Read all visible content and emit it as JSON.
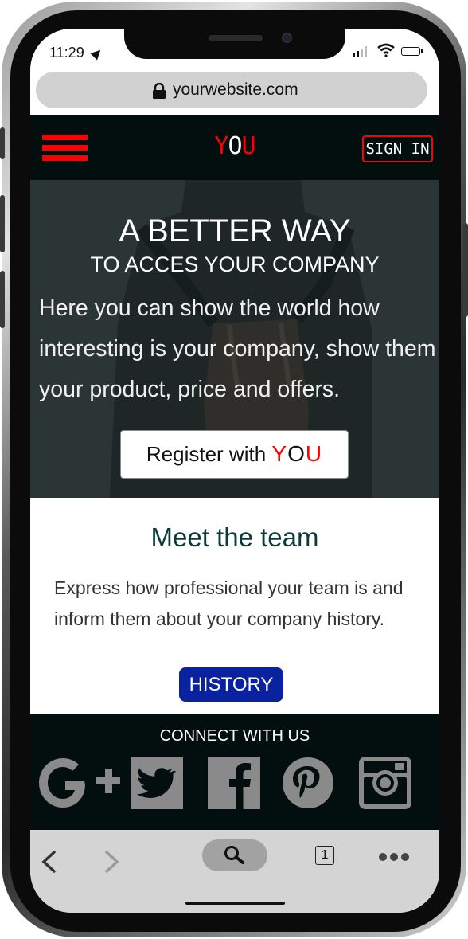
{
  "status_bar": {
    "time": "11:29"
  },
  "browser": {
    "url": "yourwebsite.com",
    "tab_count": "1"
  },
  "header": {
    "logo": {
      "part1": "Y",
      "part2": "O",
      "part3": "U"
    },
    "signin_label": "SIGN IN"
  },
  "hero": {
    "title": "A BETTER WAY",
    "subtitle": "TO ACCES YOUR COMPANY",
    "text": "Here you can show the world how interesting is your company, show them your product, price and offers.",
    "register_prefix": "Register with",
    "register_brand": {
      "part1": "Y",
      "part2": "O",
      "part3": "U"
    }
  },
  "team": {
    "title": "Meet the team",
    "text": "Express how professional your team is and inform them about your company history.",
    "history_label": "HISTORY"
  },
  "footer": {
    "title": "CONNECT WITH US",
    "social_icons": [
      "google-plus-icon",
      "twitter-icon",
      "facebook-icon",
      "pinterest-icon",
      "instagram-icon"
    ]
  },
  "colors": {
    "brand_red": "#ff0000",
    "header_bg": "#020f0e",
    "history_button": "#0a21a0",
    "team_title": "#0d3b3b"
  }
}
